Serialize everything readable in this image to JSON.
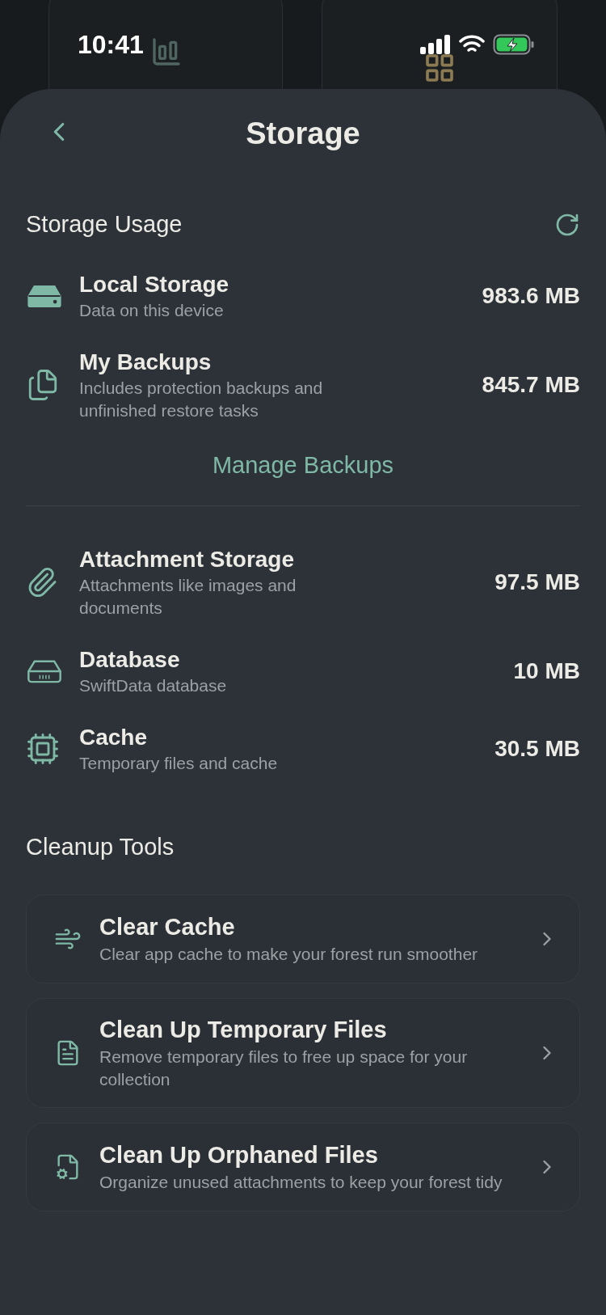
{
  "status_bar": {
    "time": "10:41"
  },
  "header": {
    "title": "Storage"
  },
  "storage_usage": {
    "title": "Storage Usage",
    "primary_items": [
      {
        "kind": "drive",
        "title": "Local Storage",
        "subtitle": "Data on this device",
        "value": "983.6 MB"
      },
      {
        "kind": "files",
        "title": "My Backups",
        "subtitle": "Includes protection backups and unfinished restore tasks",
        "value": "845.7 MB"
      }
    ],
    "link": "Manage Backups",
    "secondary_items": [
      {
        "kind": "attachment",
        "title": "Attachment Storage",
        "subtitle": "Attachments like images and documents",
        "value": "97.5 MB"
      },
      {
        "kind": "database",
        "title": "Database",
        "subtitle": "SwiftData database",
        "value": "10 MB"
      },
      {
        "kind": "chip",
        "title": "Cache",
        "subtitle": "Temporary files and cache",
        "value": "30.5 MB"
      }
    ]
  },
  "cleanup_tools": {
    "title": "Cleanup Tools",
    "tools": [
      {
        "kind": "wind",
        "title": "Clear Cache",
        "description": "Clear app cache to make your forest run smoother"
      },
      {
        "kind": "document",
        "title": "Clean Up Temporary Files",
        "description": "Remove temporary files to free up space for your collection"
      },
      {
        "kind": "file-gear",
        "title": "Clean Up Orphaned Files",
        "description": "Organize unused attachments to keep your forest tidy"
      }
    ]
  }
}
